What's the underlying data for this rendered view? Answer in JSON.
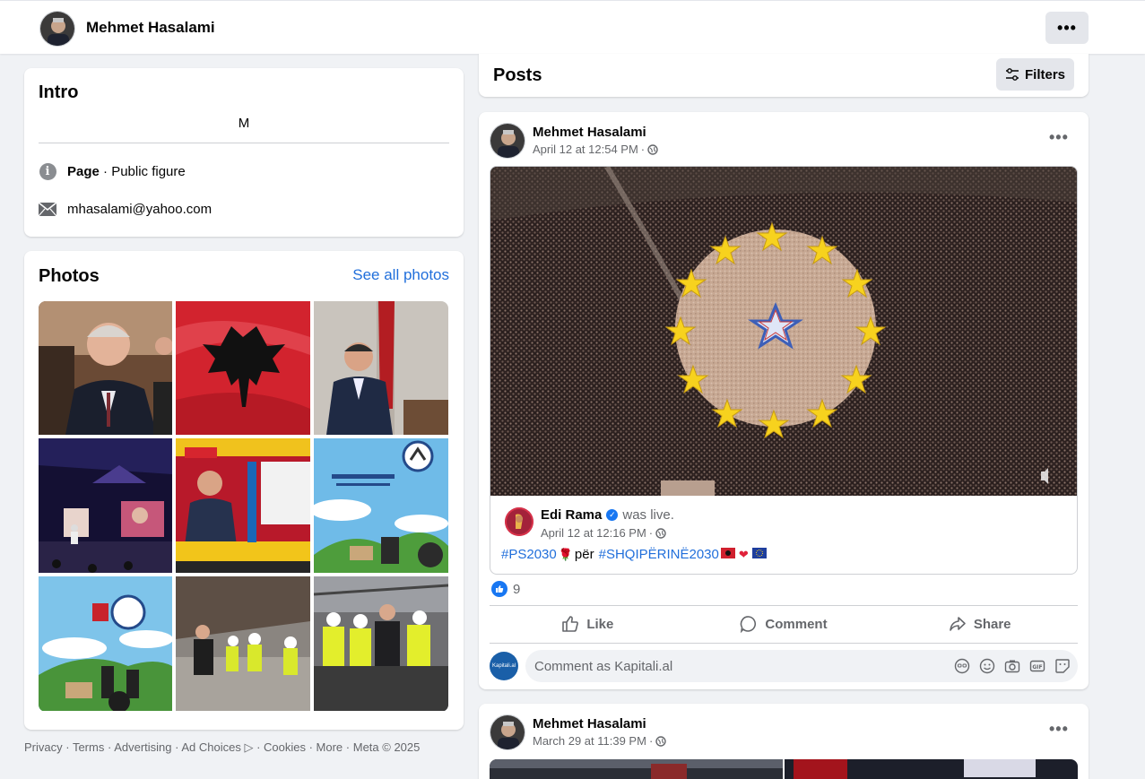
{
  "header": {
    "profile_name": "Mehmet Hasalami",
    "more_label": "•••"
  },
  "intro": {
    "title": "Intro",
    "bio": "M",
    "category_label": "Page",
    "category_value": " · Public figure",
    "email": "mhasalami@yahoo.com"
  },
  "photos": {
    "title": "Photos",
    "see_all": "See all photos"
  },
  "footer": {
    "privacy": "Privacy",
    "terms": "Terms",
    "advertising": "Advertising",
    "ad_choices": "Ad Choices",
    "cookies": "Cookies",
    "more": "More",
    "meta": "Meta © 2025"
  },
  "posts": {
    "title": "Posts",
    "filters_label": "Filters",
    "items": [
      {
        "author": "Mehmet Hasalami",
        "timestamp": "April 12 at 12:54 PM",
        "shared": {
          "author": "Edi Rama",
          "status": "was live.",
          "timestamp": "April 12 at 12:16 PM",
          "tag1": "#PS2030",
          "text_mid": "për",
          "tag2": "#SHQIPËRINË2030"
        },
        "reaction_count": "9",
        "like_label": "Like",
        "comment_label": "Comment",
        "share_label": "Share",
        "comment_placeholder": "Comment as Kapitali.al",
        "commenter_initials": "Kapitali.al"
      },
      {
        "author": "Mehmet Hasalami",
        "timestamp": "March 29 at 11:39 PM"
      }
    ]
  }
}
